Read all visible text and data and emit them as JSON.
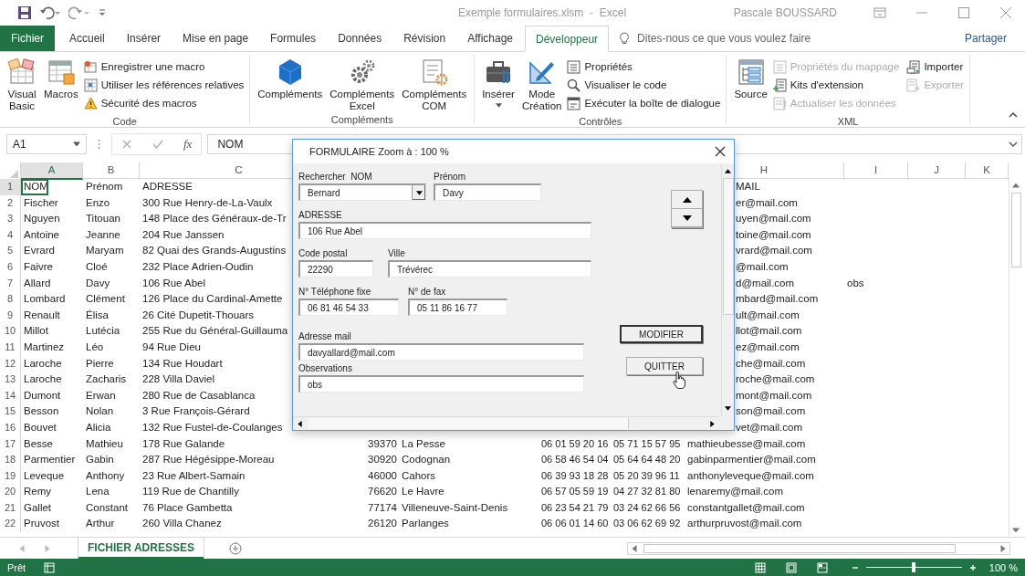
{
  "title_bar": {
    "document_title": "Exemple formulaires.xlsm  -  Excel",
    "user": "Pascale BOUSSARD"
  },
  "tabs": [
    {
      "label": "Fichier",
      "kind": "file",
      "selected": false
    },
    {
      "label": "Accueil",
      "kind": "tab",
      "selected": false
    },
    {
      "label": "Insérer",
      "kind": "tab",
      "selected": false
    },
    {
      "label": "Mise en page",
      "kind": "tab",
      "selected": false
    },
    {
      "label": "Formules",
      "kind": "tab",
      "selected": false
    },
    {
      "label": "Données",
      "kind": "tab",
      "selected": false
    },
    {
      "label": "Révision",
      "kind": "tab",
      "selected": false
    },
    {
      "label": "Affichage",
      "kind": "tab",
      "selected": false
    },
    {
      "label": "Développeur",
      "kind": "tab",
      "selected": true
    }
  ],
  "tell_me": {
    "placeholder": "Dites-nous ce que vous voulez faire"
  },
  "share_button": "Partager",
  "ribbon_groups": [
    {
      "label": "Code",
      "large": [
        {
          "label": "Visual Basic"
        },
        {
          "label": "Macros"
        }
      ],
      "small": [
        {
          "label": "Enregistrer une macro",
          "disabled": false
        },
        {
          "label": "Utiliser les références relatives",
          "disabled": false
        },
        {
          "label": "Sécurité des macros",
          "disabled": false
        }
      ]
    },
    {
      "label": "Compléments",
      "large": [
        {
          "label": "Compléments"
        },
        {
          "label": "Compléments Excel"
        },
        {
          "label": "Compléments COM"
        }
      ]
    },
    {
      "label": "Contrôles",
      "large": [
        {
          "label": "Insérer",
          "dropdown": true
        },
        {
          "label": "Mode Création"
        }
      ],
      "small": [
        {
          "label": "Propriétés",
          "disabled": false
        },
        {
          "label": "Visualiser le code",
          "disabled": false
        },
        {
          "label": "Exécuter la boîte de dialogue",
          "disabled": false
        }
      ]
    },
    {
      "label": "XML",
      "large": [
        {
          "label": "Source"
        }
      ],
      "small": [
        {
          "label": "Propriétés du mappage",
          "disabled": true
        },
        {
          "label": "Kits d'extension",
          "disabled": false
        },
        {
          "label": "Actualiser les données",
          "disabled": true
        },
        {
          "label": "Importer",
          "disabled": false
        },
        {
          "label": "Exporter",
          "disabled": true
        }
      ]
    }
  ],
  "formula_bar": {
    "name_box": "A1",
    "function_label": "fx",
    "value": "NOM"
  },
  "column_headers": [
    {
      "label": "A",
      "selected": true
    },
    {
      "label": "B",
      "selected": false
    },
    {
      "label": "C",
      "selected": false
    },
    {
      "label": "H",
      "selected": false
    },
    {
      "label": "I",
      "selected": false
    },
    {
      "label": "J",
      "selected": false
    },
    {
      "label": "K",
      "selected": false
    }
  ],
  "rows": [
    {
      "num": "1",
      "selected": true,
      "nom": "NOM",
      "prenom": "Prénom",
      "adresse": "ADRESSE",
      "mail": "MAIL"
    },
    {
      "num": "2",
      "selected": false,
      "nom": "Fischer",
      "prenom": "Enzo",
      "adresse": "300 Rue Henry-de-La-Vaulx",
      "mail": "er@mail.com"
    },
    {
      "num": "3",
      "selected": false,
      "nom": "Nguyen",
      "prenom": "Titouan",
      "adresse": "148 Place des Généraux-de-Tr",
      "mail": "uyen@mail.com"
    },
    {
      "num": "4",
      "selected": false,
      "nom": "Antoine",
      "prenom": "Jeanne",
      "adresse": "204 Rue Janssen",
      "mail": "toine@mail.com"
    },
    {
      "num": "5",
      "selected": false,
      "nom": "Evrard",
      "prenom": "Maryam",
      "adresse": "82 Quai des Grands-Augustins",
      "mail": "vrard@mail.com"
    },
    {
      "num": "6",
      "selected": false,
      "nom": "Faivre",
      "prenom": "Cloé",
      "adresse": "232 Place Adrien-Oudin",
      "mail": "@mail.com"
    },
    {
      "num": "7",
      "selected": false,
      "nom": "Allard",
      "prenom": "Davy",
      "adresse": "106 Rue Abel",
      "mail": "d@mail.com",
      "column_i": "obs"
    },
    {
      "num": "8",
      "selected": false,
      "nom": "Lombard",
      "prenom": "Clément",
      "adresse": "126 Place du Cardinal-Amette",
      "mail": "mbard@mail.com"
    },
    {
      "num": "9",
      "selected": false,
      "nom": "Renault",
      "prenom": "Élisa",
      "adresse": "26 Cité Dupetit-Thouars",
      "mail": "ult@mail.com"
    },
    {
      "num": "10",
      "selected": false,
      "nom": "Millot",
      "prenom": "Lutécia",
      "adresse": "255 Rue du Général-Guillauma",
      "mail": "llot@mail.com"
    },
    {
      "num": "11",
      "selected": false,
      "nom": "Martinez",
      "prenom": "Léo",
      "adresse": "94 Rue Dieu",
      "mail": "ez@mail.com"
    },
    {
      "num": "12",
      "selected": false,
      "nom": "Laroche",
      "prenom": "Pierre",
      "adresse": "134 Rue Houdart",
      "mail": "che@mail.com"
    },
    {
      "num": "13",
      "selected": false,
      "nom": "Laroche",
      "prenom": "Zacharis",
      "adresse": "228 Villa Daviel",
      "mail": "roche@mail.com"
    },
    {
      "num": "14",
      "selected": false,
      "nom": "Dumont",
      "prenom": "Erwan",
      "adresse": "280 Rue de Casablanca",
      "mail": "mont@mail.com"
    },
    {
      "num": "15",
      "selected": false,
      "nom": "Besson",
      "prenom": "Nolan",
      "adresse": "3 Rue François-Gérard",
      "mail": "son@mail.com"
    },
    {
      "num": "16",
      "selected": false,
      "nom": "Bouvet",
      "prenom": "Alicia",
      "adresse": "132 Rue Fustel-de-Coulanges",
      "mail": "vet@mail.com"
    },
    {
      "num": "17",
      "selected": false,
      "nom": "Besse",
      "prenom": "Mathieu",
      "adresse": "178 Rue Galande",
      "code_postal": "39370",
      "ville": "La Pesse",
      "tel": "06 01 59 20 16",
      "fax": "05 71 15 57 95",
      "mail": "mathieubesse@mail.com"
    },
    {
      "num": "18",
      "selected": false,
      "nom": "Parmentier",
      "prenom": "Gabin",
      "adresse": "287 Rue Hégésippe-Moreau",
      "code_postal": "30920",
      "ville": "Codognan",
      "tel": "06 58 46 54 04",
      "fax": "05 64 64 48 20",
      "mail": "gabinparmentier@mail.com"
    },
    {
      "num": "19",
      "selected": false,
      "nom": "Leveque",
      "prenom": "Anthony",
      "adresse": "23 Rue Albert-Samain",
      "code_postal": "46000",
      "ville": "Cahors",
      "tel": "06 39 93 18 28",
      "fax": "05 20 39 96 11",
      "mail": "anthonyleveque@mail.com"
    },
    {
      "num": "20",
      "selected": false,
      "nom": "Remy",
      "prenom": "Lena",
      "adresse": "119 Rue de Chantilly",
      "code_postal": "76620",
      "ville": "Le Havre",
      "tel": "06 57 05 59 19",
      "fax": "04 27 32 81 80",
      "mail": "lenaremy@mail.com"
    },
    {
      "num": "21",
      "selected": false,
      "nom": "Gallet",
      "prenom": "Constant",
      "adresse": "76 Place Gambetta",
      "code_postal": "77174",
      "ville": "Villeneuve-Saint-Denis",
      "tel": "06 23 54 21 79",
      "fax": "03 24 62 66 56",
      "mail": "constantgallet@mail.com"
    },
    {
      "num": "22",
      "selected": false,
      "nom": "Pruvost",
      "prenom": "Arthur",
      "adresse": "260 Villa Chanez",
      "code_postal": "26120",
      "ville": "Parlanges",
      "tel": "06 06 01 14 60",
      "fax": "03 06 62 69 92",
      "mail": "arthurpruvost@mail.com"
    }
  ],
  "form_dialog": {
    "title": "FORMULAIRE Zoom à : 100 %",
    "fields": [
      {
        "label": "Rechercher  NOM",
        "value": "Bernard",
        "kind": "combo"
      },
      {
        "label": "Prénom",
        "value": "Davy",
        "kind": "text"
      },
      {
        "label": "ADRESSE",
        "value": "106 Rue Abel",
        "kind": "text"
      },
      {
        "label": "Code postal",
        "value": "22290",
        "kind": "text"
      },
      {
        "label": "Ville",
        "value": "Trévérec",
        "kind": "text"
      },
      {
        "label": "N° Téléphone fixe",
        "value": "06 81 46 54 33",
        "kind": "text"
      },
      {
        "label": "N° de fax",
        "value": "05 11 86 16 77",
        "kind": "text"
      },
      {
        "label": "Adresse mail",
        "value": "davyallard@mail.com",
        "kind": "text"
      },
      {
        "label": "Observations",
        "value": "obs",
        "kind": "text"
      }
    ],
    "buttons": [
      {
        "label": "MODIFIER",
        "default": true
      },
      {
        "label": "QUITTER",
        "default": false
      }
    ]
  },
  "sheet_tabs": [
    {
      "label": "FICHIER ADRESSES",
      "selected": true
    }
  ],
  "status_bar": {
    "status": "Prêt",
    "zoom": {
      "level": 0.5,
      "reading": "100 %"
    }
  }
}
